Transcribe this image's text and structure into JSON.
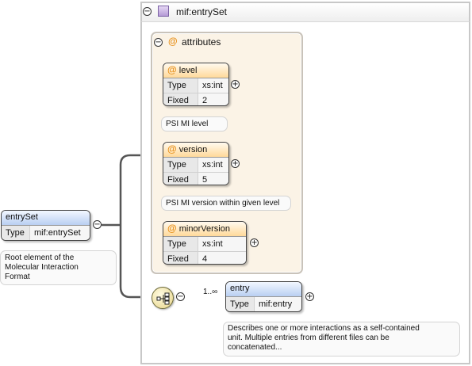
{
  "root": {
    "name": "entrySet",
    "type_label": "Type",
    "type_value": "mif:entrySet",
    "doc": [
      "Root element of the",
      "Molecular Interaction",
      "Format"
    ]
  },
  "complex_type": {
    "title": "mif:entrySet"
  },
  "attributes_group": {
    "at_symbol": "@",
    "title": "attributes",
    "items": [
      {
        "name": "level",
        "rows": [
          {
            "k": "Type",
            "v": "xs:int"
          },
          {
            "k": "Fixed",
            "v": "2"
          }
        ],
        "doc": "PSI MI level"
      },
      {
        "name": "version",
        "rows": [
          {
            "k": "Type",
            "v": "xs:int"
          },
          {
            "k": "Fixed",
            "v": "5"
          }
        ],
        "doc": "PSI MI version within given level"
      },
      {
        "name": "minorVersion",
        "rows": [
          {
            "k": "Type",
            "v": "xs:int"
          },
          {
            "k": "Fixed",
            "v": "4"
          }
        ]
      }
    ]
  },
  "entry": {
    "occurrence": "1..∞",
    "name": "entry",
    "type_label": "Type",
    "type_value": "mif:entry",
    "doc": [
      "Describes one or more interactions as a self-contained",
      "unit. Multiple entries from different files can be",
      "concatenated..."
    ]
  },
  "controls": {
    "collapse": "−",
    "expand": "+"
  },
  "colors": {
    "attribute_header": "#ffd99a",
    "element_header": "#b9cff2",
    "attributes_panel": "#fbf3e6",
    "connector": "#555555",
    "at_symbol": "#e8921e"
  },
  "icons": {
    "complex_type": "complex-type-icon",
    "sequence": "sequence-compositor-icon"
  }
}
